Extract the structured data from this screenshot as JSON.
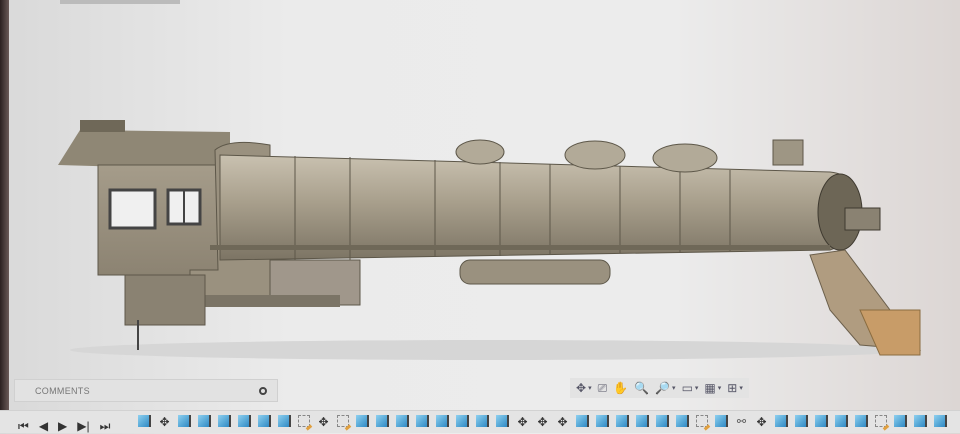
{
  "comments": {
    "label": "COMMENTS"
  },
  "navbar": {
    "items": [
      {
        "name": "orbit",
        "glyph": "✥",
        "dropdown": true
      },
      {
        "name": "look-at",
        "glyph": "⎚",
        "dropdown": false
      },
      {
        "name": "pan",
        "glyph": "✋",
        "dropdown": false
      },
      {
        "name": "zoom",
        "glyph": "🔍",
        "dropdown": false
      },
      {
        "name": "fit",
        "glyph": "🔎",
        "dropdown": true
      },
      {
        "name": "display-settings",
        "glyph": "▭",
        "dropdown": true
      },
      {
        "name": "grid-settings",
        "glyph": "▦",
        "dropdown": true
      },
      {
        "name": "viewports",
        "glyph": "⊞",
        "dropdown": true
      }
    ]
  },
  "timeline": {
    "controls": [
      "⏮",
      "◀",
      "▶",
      "▶|",
      "⏭"
    ],
    "steps": [
      "body",
      "move",
      "body",
      "body",
      "body",
      "body",
      "body",
      "body",
      "sketch",
      "move",
      "sketch",
      "body",
      "body",
      "body",
      "body",
      "body",
      "body",
      "body",
      "body",
      "move",
      "move",
      "move",
      "body",
      "body",
      "body",
      "body",
      "body",
      "body",
      "sketch",
      "body",
      "joint",
      "move",
      "body",
      "body",
      "body",
      "body",
      "body",
      "sketch",
      "body",
      "body",
      "body"
    ]
  },
  "colors": {
    "model": "#a39a88",
    "accent": "#2f8ac4"
  }
}
